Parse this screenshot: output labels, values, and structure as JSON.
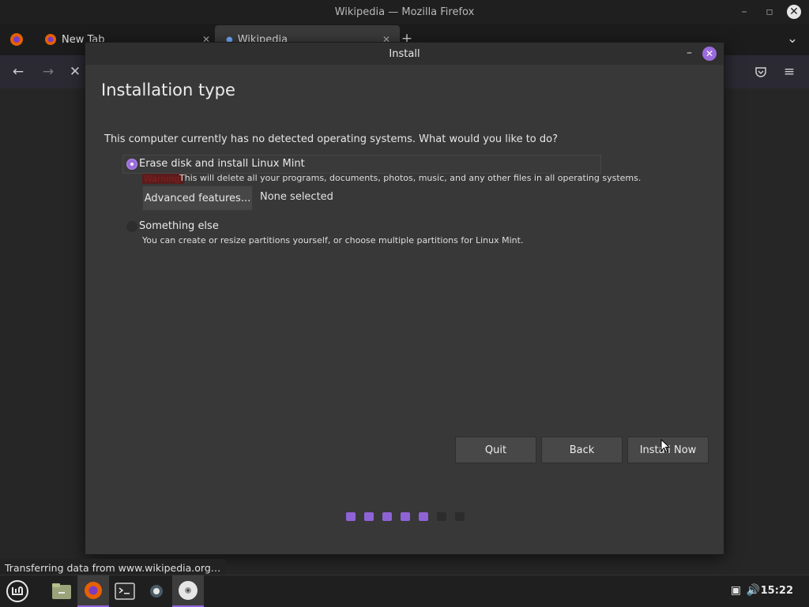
{
  "firefox": {
    "window_title": "Wikipedia — Mozilla Firefox",
    "tabs": [
      {
        "label": "New Tab"
      },
      {
        "label": "Wikipedia"
      }
    ],
    "status_text": "Transferring data from www.wikipedia.org…"
  },
  "installer": {
    "window_title": "Install",
    "page_title": "Installation type",
    "question": "This computer currently has no detected operating systems. What would you like to do?",
    "options": {
      "erase": {
        "label": "Erase disk and install Linux Mint",
        "selected": true,
        "warning_label": "Warning:",
        "warning_text": "This will delete all your programs, documents, photos, music, and any other files in all operating systems.",
        "advanced_button": "Advanced features...",
        "advanced_value": "None selected"
      },
      "something_else": {
        "label": "Something else",
        "selected": false,
        "description": "You can create or resize partitions yourself, or choose multiple partitions for Linux Mint."
      }
    },
    "buttons": {
      "quit": "Quit",
      "back": "Back",
      "install_now": "Install Now"
    },
    "progress": {
      "completed_steps": 5,
      "total_steps": 7
    }
  },
  "taskbar": {
    "clock": "15:22"
  },
  "colors": {
    "accent": "#8e63d6",
    "dialog_bg": "#383838",
    "titlebar_bg": "#1f1f1f"
  }
}
